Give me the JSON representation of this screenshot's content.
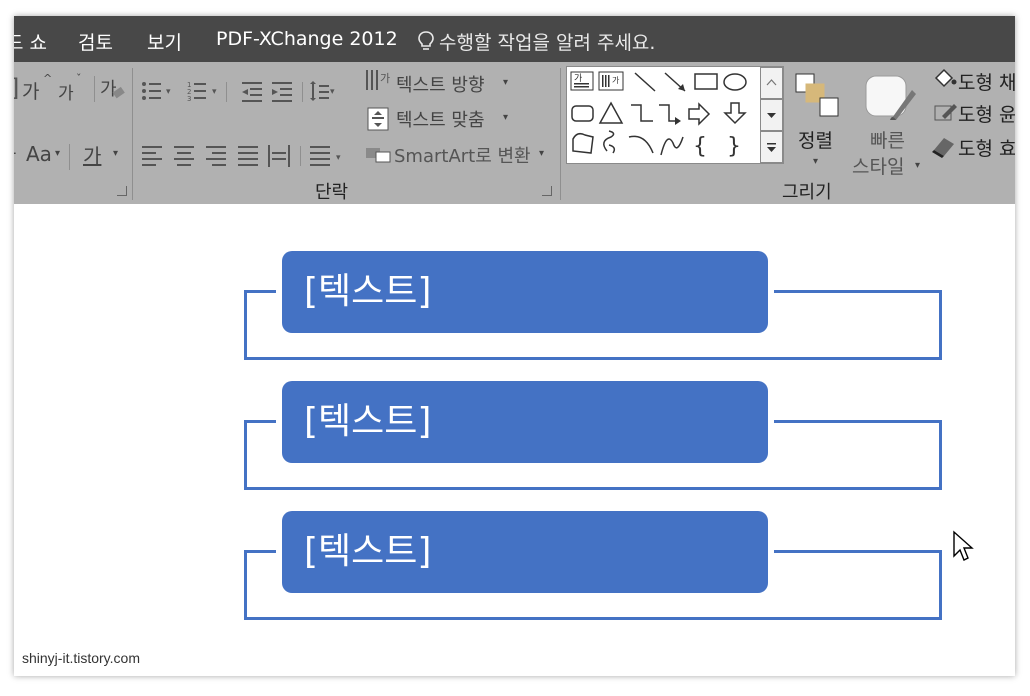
{
  "menu": {
    "partial_tab": "드 쇼",
    "tabs": [
      "검토",
      "보기",
      "PDF-XChange 2012"
    ],
    "tell_me": "수행할 작업을 알려 주세요."
  },
  "ribbon": {
    "paragraph": {
      "text_direction": "텍스트 방향",
      "text_align": "텍스트 맞춤",
      "smartart": "SmartArt로 변환",
      "group_label": "단락"
    },
    "font": {
      "font_glyph": "가",
      "grow": "가",
      "shrink": "가",
      "change_case": "Aa",
      "font_color": "가"
    },
    "drawing": {
      "arrange": "정렬",
      "quick_styles_1": "빠른",
      "quick_styles_2": "스타일",
      "shape_fill": "도형 채",
      "shape_outline": "도형 윤",
      "shape_effects": "도형 효",
      "group_label": "그리기",
      "textbox_glyph": "가"
    },
    "colors": {
      "background": "#b1b1b1",
      "menubar": "#484848"
    }
  },
  "diagram": {
    "items": [
      {
        "text": "[텍스트]"
      },
      {
        "text": "[텍스트]"
      },
      {
        "text": "[텍스트]"
      }
    ],
    "accent": "#4472c4"
  },
  "watermark": "shinyj-it.tistory.com",
  "icons": [
    "lightbulb-icon",
    "bullets-icon",
    "numbering-icon",
    "line-spacing-icon",
    "align-left-icon",
    "cursor-icon"
  ]
}
